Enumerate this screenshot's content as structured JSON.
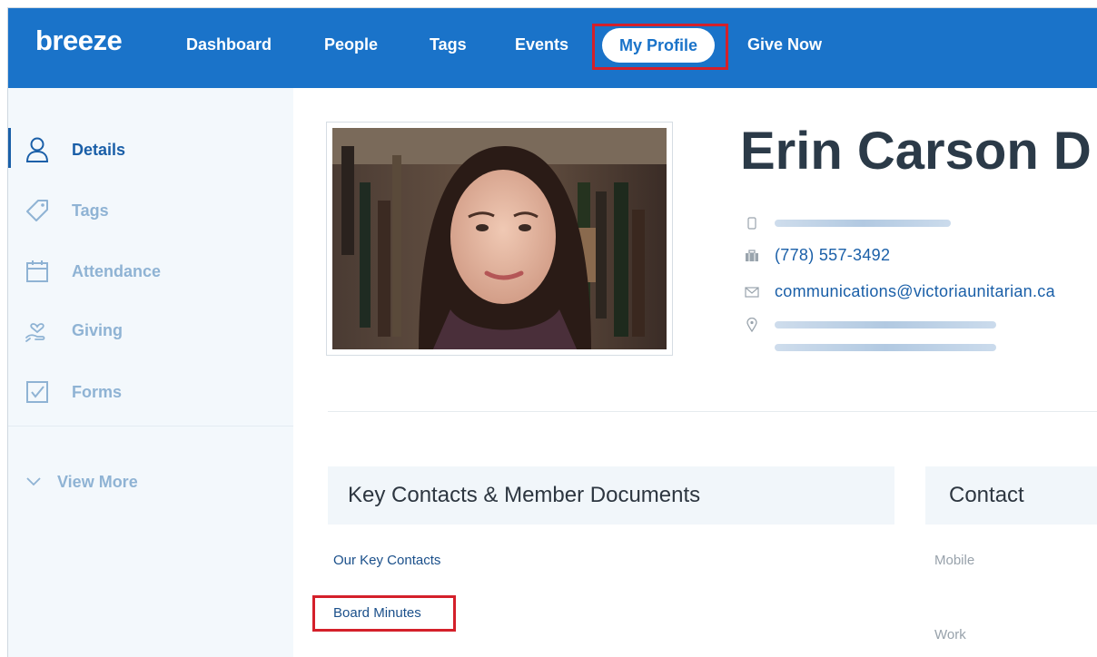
{
  "nav": {
    "logo": "breeze",
    "items": [
      "Dashboard",
      "People",
      "Tags",
      "Events"
    ],
    "active": "My Profile",
    "last": "Give Now"
  },
  "sidebar": {
    "items": [
      {
        "label": "Details",
        "icon": "person-icon",
        "active": true
      },
      {
        "label": "Tags",
        "icon": "tag-icon",
        "active": false
      },
      {
        "label": "Attendance",
        "icon": "calendar-icon",
        "active": false
      },
      {
        "label": "Giving",
        "icon": "hand-heart-icon",
        "active": false
      },
      {
        "label": "Forms",
        "icon": "checkbox-icon",
        "active": false
      }
    ],
    "view_more": "View More"
  },
  "profile": {
    "name": "Erin Carson D",
    "work_phone": "(778) 557-3492",
    "email": "communications@victoriaunitarian.ca"
  },
  "panels": {
    "documents": {
      "title": "Key Contacts & Member Documents",
      "links": [
        "Our Key Contacts",
        "Board Minutes"
      ]
    },
    "contact": {
      "title": "Contact",
      "fields": [
        "Mobile",
        "Work"
      ]
    }
  },
  "colors": {
    "brand": "#1a73c9",
    "highlight": "#d4202a",
    "sidebar_bg": "#f3f8fc"
  }
}
